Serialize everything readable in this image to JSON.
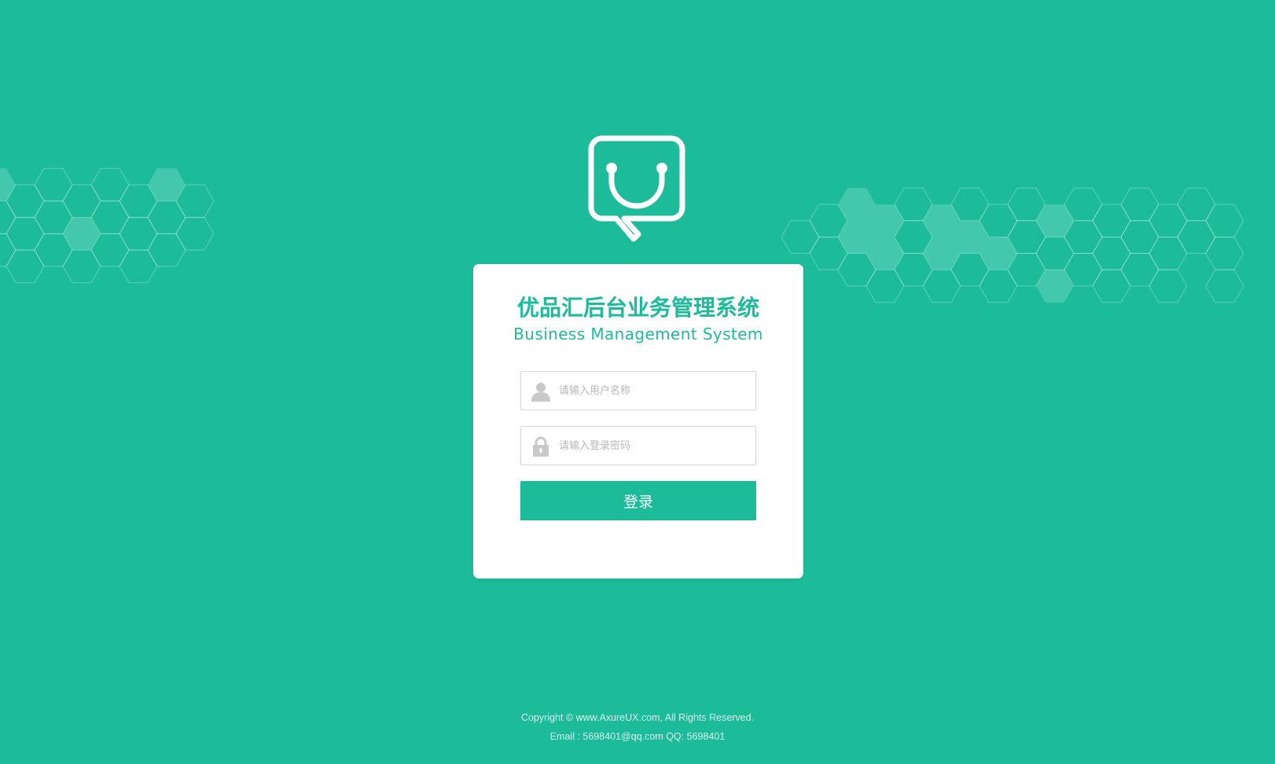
{
  "theme": {
    "accent": "#1cbc9b",
    "card_bg": "#ffffff",
    "input_border": "#d6d6d6",
    "placeholder_color": "#b8b8b8"
  },
  "logo": {
    "icon": "shopping-bag-chat-icon"
  },
  "header": {
    "title_cn": "优品汇后台业务管理系统",
    "title_en": "Business Management System"
  },
  "form": {
    "username": {
      "icon": "user-icon",
      "placeholder": "请输入用户名称",
      "value": ""
    },
    "password": {
      "icon": "lock-icon",
      "placeholder": "请输入登录密码",
      "value": ""
    },
    "submit_label": "登录"
  },
  "footer": {
    "copyright": "Copyright © www.AxureUX.com, All Rights Reserved.",
    "contact": "Email : 5698401@qq.com  QQ: 5698401"
  }
}
